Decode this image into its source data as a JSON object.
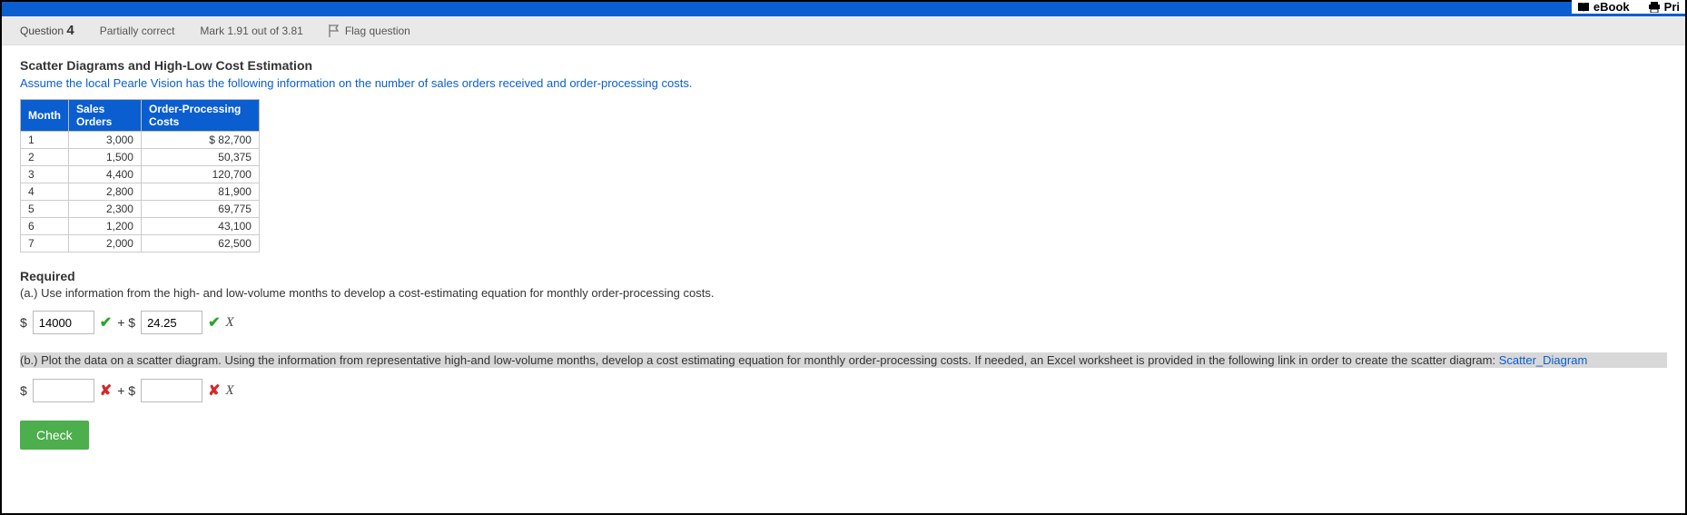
{
  "top_links": {
    "ebook": "eBook",
    "print": "Pri"
  },
  "meta": {
    "question_label": "Question",
    "question_num": "4",
    "status": "Partially correct",
    "mark": "Mark 1.91 out of 3.81",
    "flag": "Flag question"
  },
  "title": "Scatter Diagrams and High-Low Cost Estimation",
  "desc": "Assume the local Pearle Vision has the following information on the number of sales orders received and order-processing costs.",
  "table": {
    "headers": {
      "month": "Month",
      "orders": "Sales Orders",
      "cost": "Order-Processing Costs"
    },
    "rows": [
      {
        "month": "1",
        "orders": "3,000",
        "cost": "$ 82,700"
      },
      {
        "month": "2",
        "orders": "1,500",
        "cost": "50,375"
      },
      {
        "month": "3",
        "orders": "4,400",
        "cost": "120,700"
      },
      {
        "month": "4",
        "orders": "2,800",
        "cost": "81,900"
      },
      {
        "month": "5",
        "orders": "2,300",
        "cost": "69,775"
      },
      {
        "month": "6",
        "orders": "1,200",
        "cost": "43,100"
      },
      {
        "month": "7",
        "orders": "2,000",
        "cost": "62,500"
      }
    ]
  },
  "required": "Required",
  "part_a": "(a.) Use information from the high- and low-volume months to develop a cost-estimating equation for monthly order-processing costs.",
  "answers_a": {
    "fixed": "14000",
    "var": "24.25"
  },
  "part_b_text": "(b.) Plot the data on a scatter diagram. Using the information from representative high-and low-volume months, develop a cost estimating equation for monthly order-processing costs. If needed, an Excel worksheet is provided in the following link in order to create the scatter diagram: ",
  "part_b_link": "Scatter_Diagram",
  "answers_b": {
    "fixed": "",
    "var": ""
  },
  "symbols": {
    "dollar": "$",
    "plus_dollar": "+ $",
    "x": "X",
    "check": "✔",
    "cross": "✘"
  },
  "check_label": "Check"
}
